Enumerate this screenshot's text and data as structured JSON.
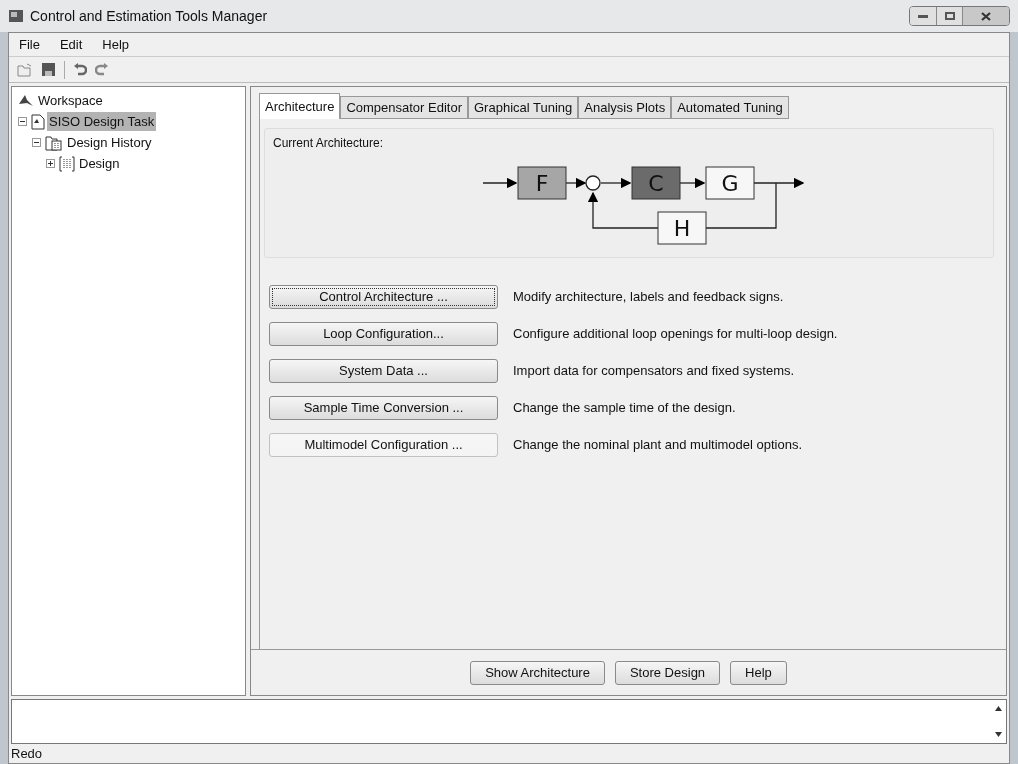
{
  "window": {
    "title": "Control and Estimation Tools Manager"
  },
  "menu": [
    "File",
    "Edit",
    "Help"
  ],
  "tree": [
    {
      "label": "Workspace",
      "kind": "workspace",
      "selected": false,
      "children": [
        {
          "label": "SISO Design Task",
          "kind": "task",
          "selected": true,
          "expanded": true,
          "children": [
            {
              "label": "Design History",
              "kind": "history",
              "selected": false,
              "expanded": true,
              "children": [
                {
                  "label": "Design",
                  "kind": "design",
                  "selected": false,
                  "expanded": false
                }
              ]
            }
          ]
        }
      ]
    }
  ],
  "tabs": [
    {
      "label": "Architecture",
      "selected": true
    },
    {
      "label": "Compensator Editor",
      "selected": false
    },
    {
      "label": "Graphical Tuning",
      "selected": false
    },
    {
      "label": "Analysis Plots",
      "selected": false
    },
    {
      "label": "Automated Tuning",
      "selected": false
    }
  ],
  "architecture": {
    "title": "Current Architecture:",
    "blocks": [
      {
        "label": "F",
        "color": "#a6a6a6"
      },
      {
        "label": "C",
        "color": "#6b6b6b"
      },
      {
        "label": "G",
        "color": "#f7f7f7"
      },
      {
        "label": "H",
        "color": "#f7f7f7"
      }
    ]
  },
  "actions": [
    {
      "button": "Control Architecture ...",
      "description": "Modify architecture, labels and feedback signs.",
      "disabled": false,
      "focused": true
    },
    {
      "button": "Loop Configuration...",
      "description": "Configure additional loop openings for multi-loop design.",
      "disabled": false,
      "focused": false
    },
    {
      "button": "System Data ...",
      "description": "Import data for compensators and fixed systems.",
      "disabled": false,
      "focused": false
    },
    {
      "button": "Sample Time Conversion ...",
      "description": "Change the sample time of the design.",
      "disabled": false,
      "focused": false
    },
    {
      "button": "Multimodel Configuration ...",
      "description": "Change the nominal plant and multimodel options.",
      "disabled": true,
      "focused": false
    }
  ],
  "footer_buttons": [
    "Show Architecture",
    "Store Design",
    "Help"
  ],
  "status_bar": "Redo"
}
